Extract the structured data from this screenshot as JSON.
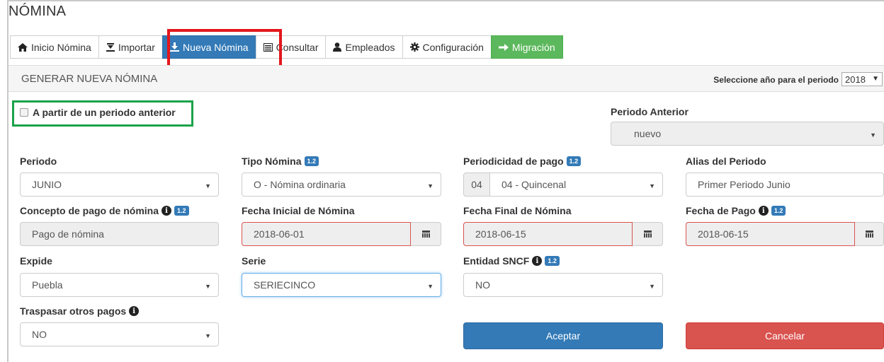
{
  "app": {
    "title": "NÓMINA"
  },
  "tabs": [
    {
      "label": "Inicio Nómina",
      "icon": "home-icon"
    },
    {
      "label": "Importar",
      "icon": "import-icon"
    },
    {
      "label": "Nueva Nómina",
      "icon": "download-icon"
    },
    {
      "label": "Consultar",
      "icon": "list-icon"
    },
    {
      "label": "Empleados",
      "icon": "user-icon"
    },
    {
      "label": "Configuración",
      "icon": "gear-icon"
    },
    {
      "label": "Migración",
      "icon": "arrow-right-icon"
    }
  ],
  "section": {
    "title": "GENERAR NUEVA NÓMINA",
    "year_label": "Seleccione año para el periodo",
    "year_value": "2018"
  },
  "previous": {
    "checkbox_label": "A partir de un periodo anterior",
    "checked": false,
    "periodo_anterior_label": "Periodo Anterior",
    "periodo_anterior_value": "nuevo"
  },
  "form": {
    "periodo": {
      "label": "Periodo",
      "value": "JUNIO"
    },
    "tipo_nomina": {
      "label": "Tipo Nómina",
      "badge": "1.2",
      "value": "O - Nómina ordinaria"
    },
    "periodicidad": {
      "label": "Periodicidad de pago",
      "badge": "1.2",
      "code": "04",
      "value": "04 - Quincenal"
    },
    "alias": {
      "label": "Alias del Periodo",
      "value": "Primer Periodo Junio"
    },
    "concepto": {
      "label": "Concepto de pago de nómina",
      "badge": "1.2",
      "value": "Pago de nómina"
    },
    "fecha_inicial": {
      "label": "Fecha Inicial de Nómina",
      "value": "2018-06-01"
    },
    "fecha_final": {
      "label": "Fecha Final de Nómina",
      "value": "2018-06-15"
    },
    "fecha_pago": {
      "label": "Fecha de Pago",
      "badge": "1.2",
      "value": "2018-06-15"
    },
    "expide": {
      "label": "Expide",
      "value": "Puebla"
    },
    "serie": {
      "label": "Serie",
      "value": "SERIECINCO"
    },
    "entidad": {
      "label": "Entidad SNCF",
      "badge": "1.2",
      "value": "NO"
    },
    "traspasar": {
      "label": "Traspasar otros pagos",
      "value": "NO"
    }
  },
  "actions": {
    "accept": "Aceptar",
    "cancel": "Cancelar"
  },
  "colors": {
    "primary": "#337ab7",
    "success": "#5cb85c",
    "danger": "#d9534f",
    "highlight_red": "#e3171c",
    "highlight_green": "#1ba24a"
  }
}
